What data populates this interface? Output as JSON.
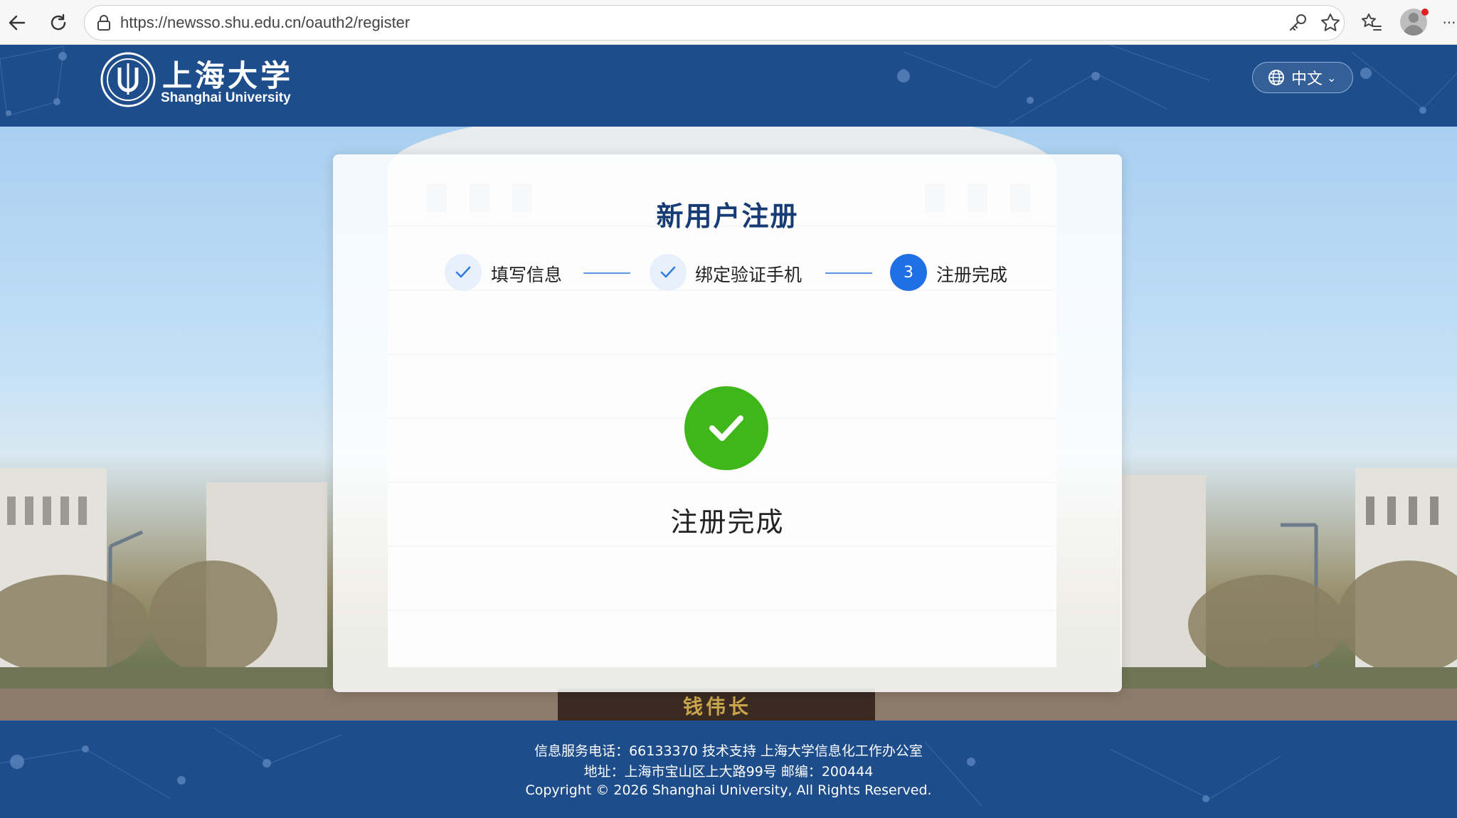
{
  "browser": {
    "url": "https://newsso.shu.edu.cn/oauth2/register",
    "back_icon": "back-arrow-icon",
    "reload_icon": "reload-icon",
    "lock_icon": "lock-icon",
    "key_icon": "key-icon",
    "star_icon": "star-icon",
    "favorites_icon": "favorites-icon",
    "menu_glyph": "···"
  },
  "header": {
    "logo_cn": "上海大学",
    "logo_en": "Shanghai University",
    "language_label": "中文"
  },
  "hero": {
    "statue_inscription": "钱伟长"
  },
  "card": {
    "title": "新用户注册",
    "steps": [
      {
        "label": "填写信息",
        "state": "done"
      },
      {
        "label": "绑定验证手机",
        "state": "done"
      },
      {
        "label": "注册完成",
        "state": "active",
        "number": "3"
      }
    ],
    "success_text": "注册完成"
  },
  "footer": {
    "line1": "信息服务电话：66133370 技术支持 上海大学信息化工作办公室",
    "line2": "地址：上海市宝山区上大路99号 邮编：200444",
    "line3": "Copyright © 2026 Shanghai University, All Rights Reserved."
  },
  "colors": {
    "header_bg": "#1e4d8c",
    "title": "#173b74",
    "step_active": "#1f6fe5",
    "success": "#3fb71a"
  }
}
